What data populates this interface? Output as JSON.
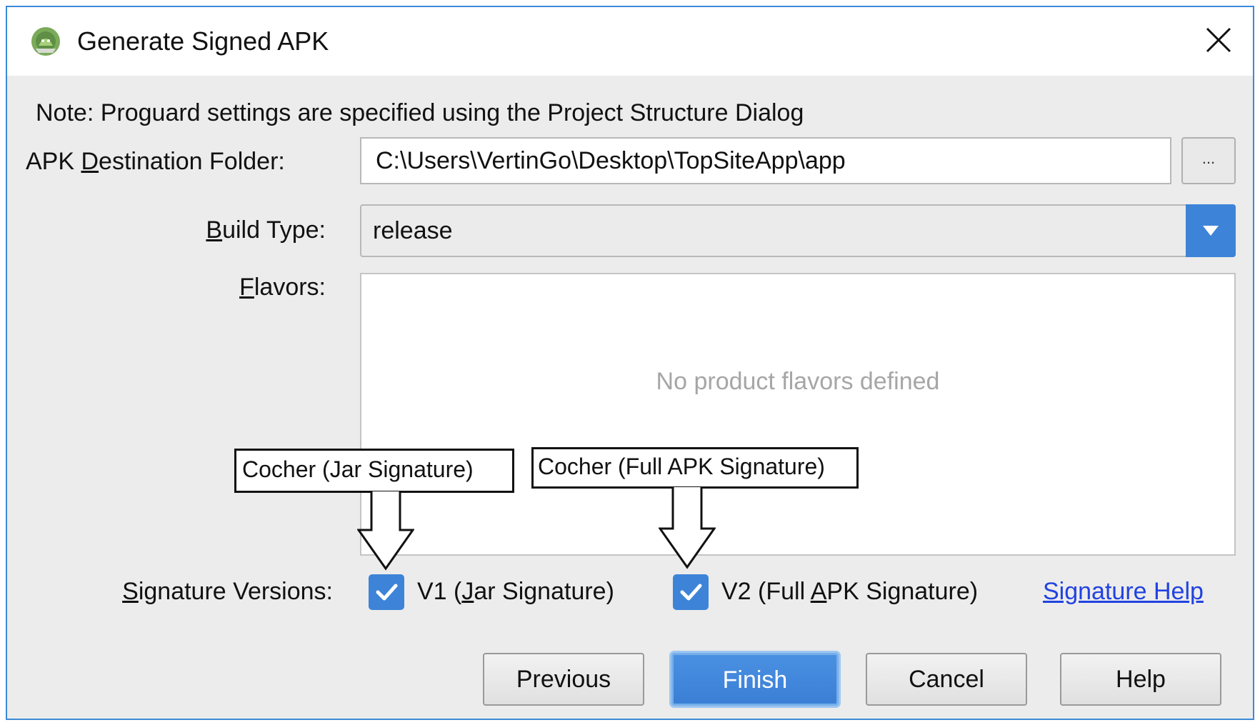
{
  "window": {
    "title": "Generate Signed APK"
  },
  "note": "Note: Proguard settings are specified using the Project Structure Dialog",
  "destination": {
    "label_before": "APK ",
    "label_mnemonic": "D",
    "label_after": "estination Folder:",
    "value": "C:\\Users\\VertinGo\\Desktop\\TopSiteApp\\app",
    "browse_label": "..."
  },
  "build_type": {
    "label_mnemonic": "B",
    "label_after": "uild Type:",
    "value": "release"
  },
  "flavors": {
    "label_mnemonic": "F",
    "label_after": "lavors:",
    "empty_text": "No product flavors defined"
  },
  "annotations": {
    "v1": "Cocher (Jar Signature)",
    "v2": "Cocher (Full APK Signature)"
  },
  "signature": {
    "label_mnemonic": "S",
    "label_after": "ignature Versions:",
    "v1": {
      "checked": true,
      "label_before": "V1 (",
      "label_mnemonic": "J",
      "label_after": "ar Signature)"
    },
    "v2": {
      "checked": true,
      "label_before": "V2 (Full ",
      "label_mnemonic": "A",
      "label_after": "PK Signature)"
    },
    "help_link": "Signature Help"
  },
  "buttons": {
    "previous": "Previous",
    "finish": "Finish",
    "cancel": "Cancel",
    "help": "Help"
  },
  "colors": {
    "accent": "#3d84d8",
    "link": "#2142e0",
    "border": "#3c8ad8"
  }
}
